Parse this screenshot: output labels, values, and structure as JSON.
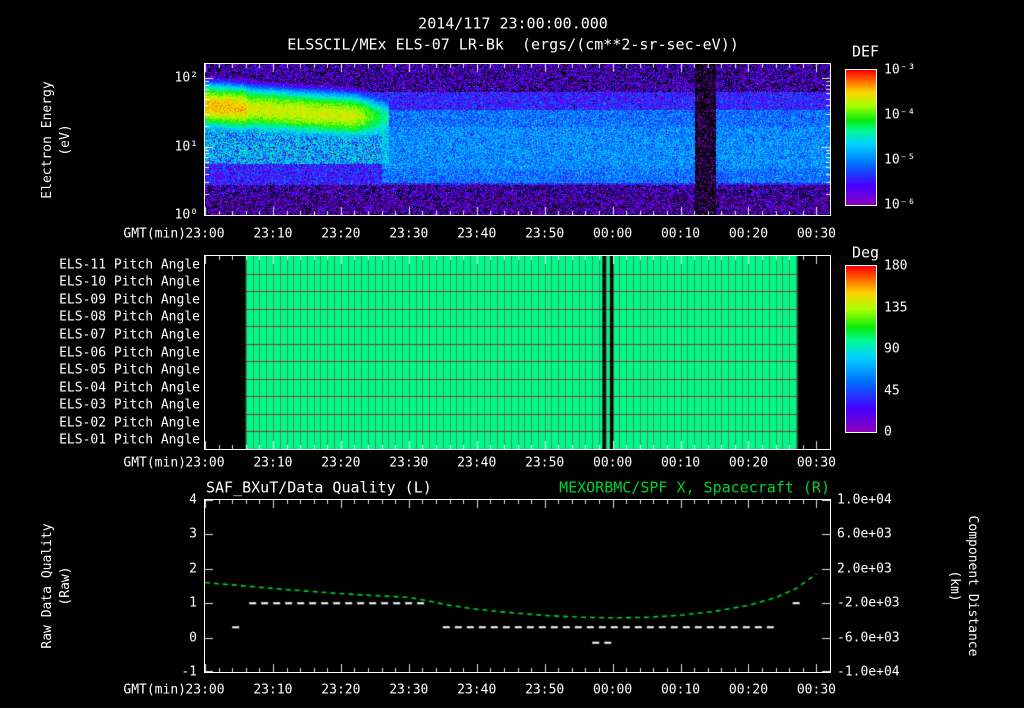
{
  "page": {
    "title": "2014/117 23:00:00.000",
    "subtitle": "ELSSCIL/MEx ELS-07 LR-Bk  (ergs/(cm**2-sr-sec-eV))"
  },
  "colors": {
    "background": "#000000",
    "text": "#ffffff",
    "accent_green": "#00d22d"
  },
  "axes": {
    "x_label": "GMT(min)",
    "x_ticks": [
      "23:00",
      "23:10",
      "23:20",
      "23:30",
      "23:40",
      "23:50",
      "00:00",
      "00:10",
      "00:20",
      "00:30"
    ],
    "x_tick_minutes": [
      0,
      10,
      20,
      30,
      40,
      50,
      60,
      70,
      80,
      90
    ],
    "x_range_minutes": [
      0,
      92
    ]
  },
  "spectrogram": {
    "ylabel_line1": "Electron Energy",
    "ylabel_line2": "(eV)",
    "y_ticks": [
      "10²",
      "10¹",
      "10⁰"
    ],
    "colorbar": {
      "label": "DEF",
      "ticks": [
        "10⁻³",
        "10⁻⁴",
        "10⁻⁵",
        "10⁻⁶"
      ]
    }
  },
  "pitch": {
    "rows": [
      "ELS-11 Pitch Angle",
      "ELS-10 Pitch Angle",
      "ELS-09 Pitch Angle",
      "ELS-08 Pitch Angle",
      "ELS-07 Pitch Angle",
      "ELS-06 Pitch Angle",
      "ELS-05 Pitch Angle",
      "ELS-04 Pitch Angle",
      "ELS-03 Pitch Angle",
      "ELS-02 Pitch Angle",
      "ELS-01 Pitch Angle"
    ],
    "colorbar": {
      "label": "Deg",
      "ticks": [
        "180",
        "135",
        "90",
        "45",
        "0"
      ]
    }
  },
  "bottom": {
    "title_left": "SAF_BXuT/Data Quality (L)",
    "title_right": "MEXORBMC/SPF X, Spacecraft (R)",
    "ylabel_left_line1": "Raw Data Quality",
    "ylabel_left_line2": "(Raw)",
    "ylabel_right_line1": "Component Distance",
    "ylabel_right_line2": "(km)",
    "yticks_left": [
      "4",
      "3",
      "2",
      "1",
      "0",
      "-1"
    ],
    "yticks_right": [
      "1.0e+04",
      "6.0e+03",
      "2.0e+03",
      "-2.0e+03",
      "-6.0e+03",
      "-1.0e+04"
    ]
  },
  "chart_data": [
    {
      "type": "heatmap",
      "name": "electron-energy-spectrogram",
      "title": "ELSSCIL/MEx ELS-07 LR-Bk",
      "units": "ergs/(cm**2-sr-sec-eV)",
      "x_axis": {
        "label": "GMT(min)",
        "tick_labels": [
          "23:00",
          "23:10",
          "23:20",
          "23:30",
          "23:40",
          "23:50",
          "00:00",
          "00:10",
          "00:20",
          "00:30"
        ],
        "range_minutes": [
          0,
          92
        ]
      },
      "y_axis": {
        "label": "Electron Energy (eV)",
        "scale": "log",
        "range_ev": [
          1,
          158
        ]
      },
      "z_axis": {
        "label": "DEF",
        "scale": "log",
        "range": [
          1e-06,
          0.001
        ]
      },
      "features": {
        "background_log10_flux_range": [
          -6.35,
          -5.4
        ],
        "beam_band": {
          "t_min": [
            0,
            27
          ],
          "energy_center_ev": [
            40,
            26
          ],
          "peak_log10_flux_start": -3.45,
          "peak_log10_flux_mid": -3.65,
          "fade_after_min": 22
        },
        "broad_enhancement": {
          "t_min": [
            26,
            92
          ],
          "energy_ev": [
            3,
            35
          ],
          "log10_flux_range": [
            -5.6,
            -4.6
          ]
        },
        "data_gap_t_min": [
          72,
          75.2
        ]
      }
    },
    {
      "type": "heatmap",
      "name": "pitch-angle-panels",
      "rows": [
        "ELS-11",
        "ELS-10",
        "ELS-09",
        "ELS-08",
        "ELS-07",
        "ELS-06",
        "ELS-05",
        "ELS-04",
        "ELS-03",
        "ELS-02",
        "ELS-01"
      ],
      "z_axis": {
        "label": "Deg",
        "range": [
          0,
          180
        ]
      },
      "uniform_value_deg": 100,
      "coverage_t_min": [
        6,
        87.2
      ],
      "gaps_t_min": [
        [
          58.5,
          59.0
        ],
        [
          59.6,
          60.1
        ]
      ]
    },
    {
      "type": "line",
      "name": "quality-and-distance",
      "left_axis": {
        "label": "Raw Data Quality (Raw)",
        "range": [
          -1,
          4
        ]
      },
      "right_axis": {
        "label": "Component Distance (km)",
        "range": [
          -10000,
          10000
        ]
      },
      "series": [
        {
          "name": "MEXORBMC/SPF X, Spacecraft (R)",
          "axis": "right",
          "color": "#00d22d",
          "style": "dashed",
          "x_min": [
            0,
            5,
            10,
            15,
            20,
            25,
            30,
            33,
            36,
            40,
            45,
            50,
            55,
            60,
            65,
            70,
            75,
            80,
            84,
            87,
            90
          ],
          "y_km": [
            400,
            60,
            -280,
            -600,
            -880,
            -1120,
            -1320,
            -1750,
            -2250,
            -2700,
            -3100,
            -3420,
            -3620,
            -3700,
            -3650,
            -3400,
            -2950,
            -2250,
            -1350,
            -300,
            1400
          ]
        },
        {
          "name": "SAF_BXuT/Data Quality (L)",
          "axis": "left",
          "color": "#ffffff",
          "style": "dashed",
          "segments": [
            {
              "t_min": [
                4.0,
                5.2
              ],
              "value": 0.3
            },
            {
              "t_min": [
                6.5,
                32.5
              ],
              "value": 1.0
            },
            {
              "t_min": [
                35,
                84
              ],
              "value": 0.3
            },
            {
              "t_min": [
                57,
                60.5
              ],
              "value": -0.15
            },
            {
              "t_min": [
                86.5,
                88
              ],
              "value": 1.0
            }
          ]
        }
      ]
    }
  ]
}
